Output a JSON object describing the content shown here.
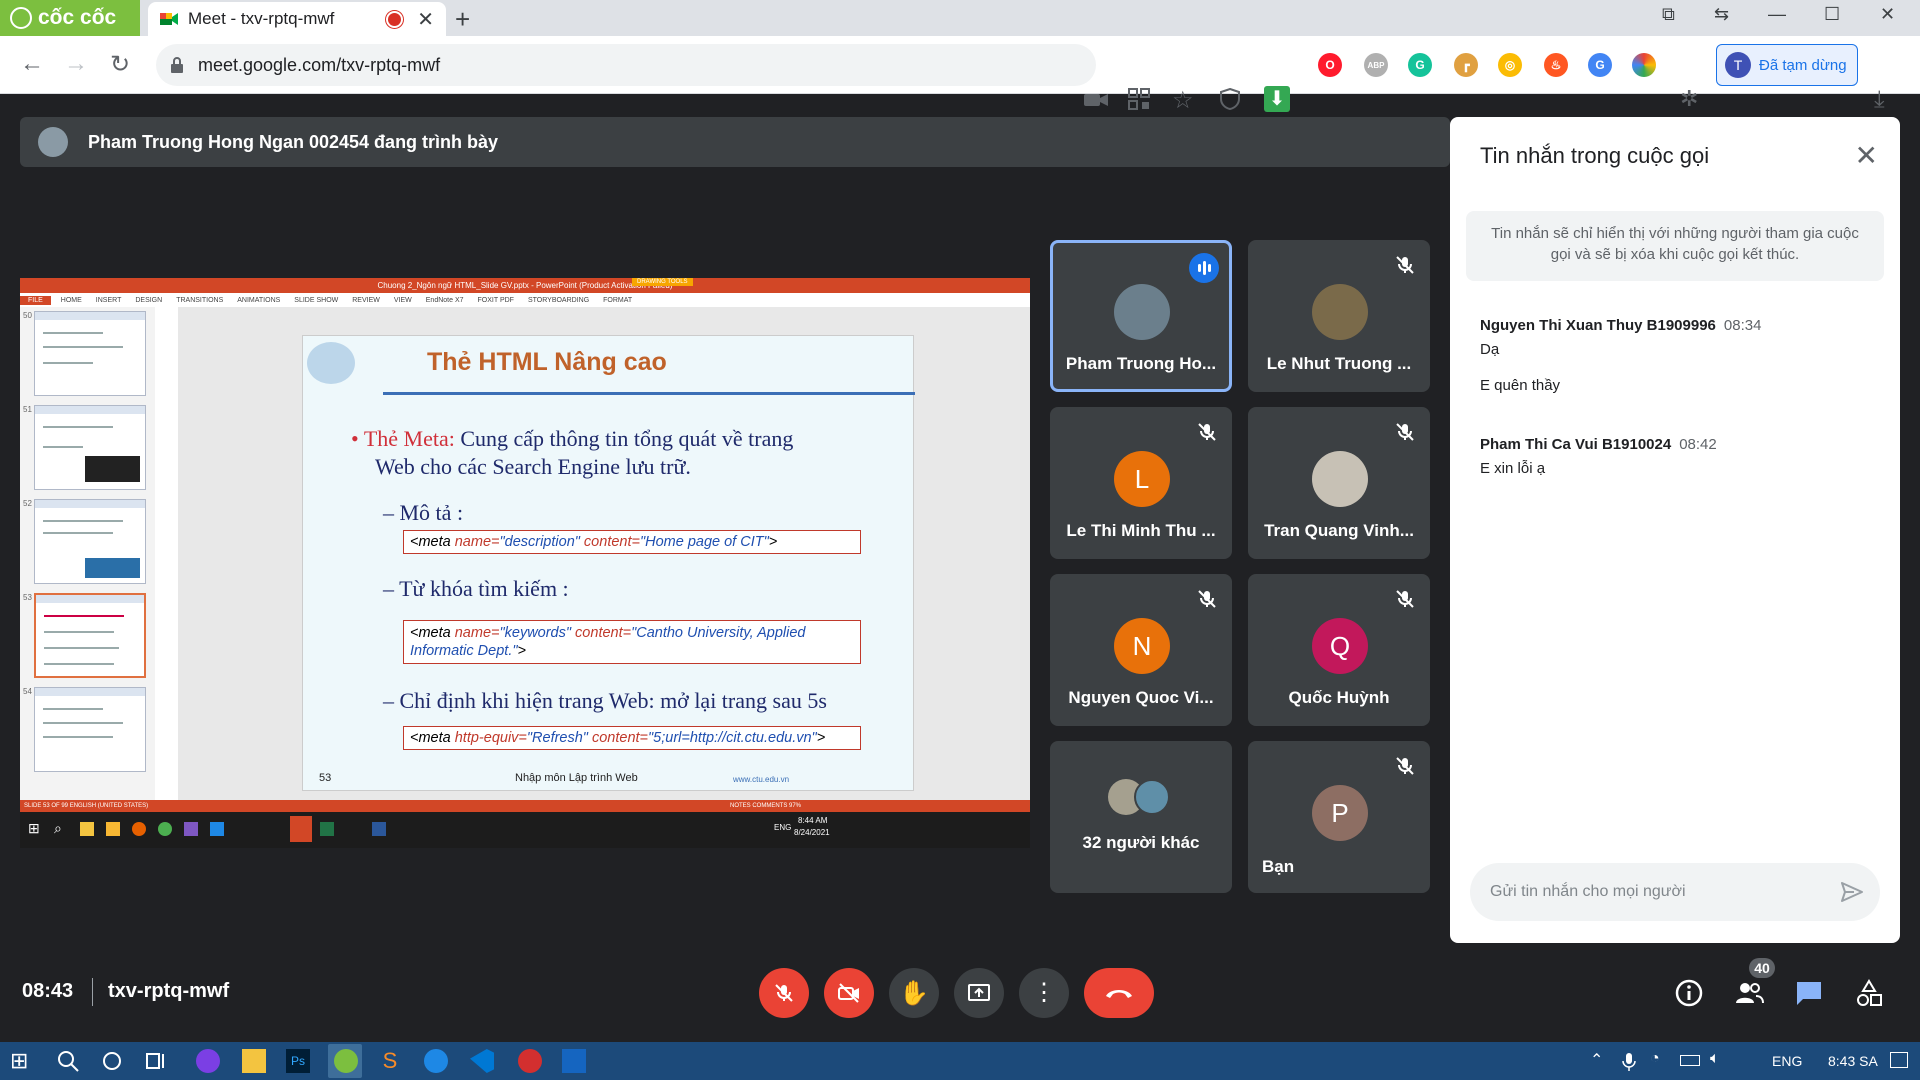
{
  "browser": {
    "brand": "cốc cốc",
    "tab_title": "Meet - txv-rptq-mwf",
    "url": "meet.google.com/txv-rptq-mwf",
    "profile_initial": "T",
    "profile_label": "Đã tạm dừng"
  },
  "presenter_bar": {
    "text": "Pham Truong Hong Ngan 002454 đang trình bày"
  },
  "slide": {
    "window_title": "Chuong 2_Ngôn ngữ HTML_Slide GV.pptx - PowerPoint (Product Activation Failed)",
    "ribbon_tabs": [
      "FILE",
      "HOME",
      "INSERT",
      "DESIGN",
      "TRANSITIONS",
      "ANIMATIONS",
      "SLIDE SHOW",
      "REVIEW",
      "VIEW",
      "EndNote X7",
      "FOXIT PDF",
      "STORYBOARDING",
      "FORMAT"
    ],
    "drawing_tools": "DRAWING TOOLS",
    "thumb_numbers": [
      "50",
      "51",
      "52",
      "53",
      "54"
    ],
    "title": "Thẻ HTML Nâng cao",
    "bullet_label": "Thẻ Meta:",
    "bullet_text_1": "Cung cấp thông tin tổng quát về trang",
    "bullet_text_2": "Web cho các Search Engine lưu trữ.",
    "sub1": "– Mô tả :",
    "code1": {
      "pre": "<meta ",
      "name_attr": "name=",
      "name_val": "\"description\"",
      "content_attr": " content=",
      "content_val": "\"Home page of CIT\"",
      "post": ">"
    },
    "sub2": "– Từ khóa tìm kiếm :",
    "code2": {
      "pre": "<meta ",
      "name_attr": "name=",
      "name_val": "\"keywords\"",
      "content_attr": " content=",
      "content_val": "\"Cantho University, Applied Informatic Dept.\"",
      "post": ">"
    },
    "sub3": "– Chỉ định khi hiện trang Web: mở lại trang sau 5s",
    "code3": {
      "pre": "<meta ",
      "name_attr": "http-equiv=",
      "name_val": "\"Refresh\"",
      "content_attr": "  content=",
      "content_val": "\"5;url=http://cit.ctu.edu.vn\"",
      "post": ">"
    },
    "page_number": "53",
    "footer": "Nhập môn Lập trình Web",
    "footer_url": "www.ctu.edu.vn",
    "status_left": "SLIDE 53 OF 99    ENGLISH (UNITED STATES)",
    "status_right": "NOTES   COMMENTS   97%",
    "task_time": "8:44 AM",
    "task_date": "8/24/2021",
    "task_lang": "ENG"
  },
  "participants": [
    {
      "name": "Pham Truong Ho...",
      "initial": "",
      "avatar_color": "#6b7f8c",
      "speaking": true,
      "muted": false
    },
    {
      "name": "Le Nhut Truong ...",
      "initial": "",
      "avatar_color": "#7a6a4a",
      "speaking": false,
      "muted": true
    },
    {
      "name": "Le Thi Minh Thu ...",
      "initial": "L",
      "avatar_color": "#e8710a",
      "speaking": false,
      "muted": true
    },
    {
      "name": "Tran Quang Vinh...",
      "initial": "",
      "avatar_color": "#c7c1b5",
      "speaking": false,
      "muted": true
    },
    {
      "name": "Nguyen Quoc Vi...",
      "initial": "N",
      "avatar_color": "#e8710a",
      "speaking": false,
      "muted": true
    },
    {
      "name": "Quốc Huỳnh",
      "initial": "Q",
      "avatar_color": "#c2185b",
      "speaking": false,
      "muted": true
    },
    {
      "name": "32 người khác",
      "initial": "",
      "avatar_color": "#5f6368",
      "speaking": false,
      "muted": false
    },
    {
      "name": "Bạn",
      "initial": "P",
      "avatar_color": "#8d6e63",
      "speaking": false,
      "muted": true
    }
  ],
  "chat": {
    "title": "Tin nhắn trong cuộc gọi",
    "notice": "Tin nhắn sẽ chỉ hiển thị với những người tham gia cuộc gọi và sẽ bị xóa khi cuộc gọi kết thúc.",
    "messages": [
      {
        "sender": "Nguyen Thi Xuan Thuy B1909996",
        "time": "08:34",
        "lines": [
          "Dạ",
          "E quên thầy"
        ]
      },
      {
        "sender": "Pham Thi Ca Vui B1910024",
        "time": "08:42",
        "lines": [
          "E xin lỗi ạ"
        ]
      }
    ],
    "input_placeholder": "Gửi tin nhắn cho mọi người"
  },
  "bottom_bar": {
    "time": "08:43",
    "meeting_code": "txv-rptq-mwf",
    "participant_count": "40"
  },
  "windows_taskbar": {
    "lang": "ENG",
    "time": "8:43 SA"
  },
  "colors": {
    "meet_bg": "#202124",
    "tile_bg": "#3c4043",
    "danger": "#ea4335",
    "accent": "#1a73e8",
    "powerpoint": "#d24726"
  }
}
